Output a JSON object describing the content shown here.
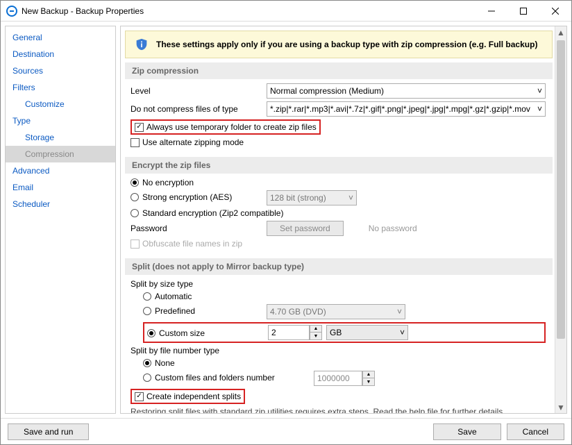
{
  "window": {
    "title": "New Backup - Backup Properties"
  },
  "sidebar": {
    "items": [
      {
        "label": "General"
      },
      {
        "label": "Destination"
      },
      {
        "label": "Sources"
      },
      {
        "label": "Filters"
      },
      {
        "label": "Customize"
      },
      {
        "label": "Type"
      },
      {
        "label": "Storage"
      },
      {
        "label": "Compression"
      },
      {
        "label": "Advanced"
      },
      {
        "label": "Email"
      },
      {
        "label": "Scheduler"
      }
    ]
  },
  "banner": {
    "text": "These settings apply only if you are using a backup type with zip compression (e.g. Full backup)"
  },
  "zip": {
    "header": "Zip compression",
    "level_label": "Level",
    "level_value": "Normal compression (Medium)",
    "nocompress_label": "Do not compress files of type",
    "nocompress_value": "*.zip|*.rar|*.mp3|*.avi|*.7z|*.gif|*.png|*.jpeg|*.jpg|*.mpg|*.gz|*.gzip|*.mov",
    "temp_label": "Always use temporary folder to create zip files",
    "altmode_label": "Use alternate zipping mode"
  },
  "enc": {
    "header": "Encrypt the zip files",
    "none": "No encryption",
    "aes": "Strong encryption (AES)",
    "aes_bits": "128 bit (strong)",
    "zip2": "Standard encryption (Zip2 compatible)",
    "pw_label": "Password",
    "pw_button": "Set password",
    "pw_status": "No password",
    "obfuscate": "Obfuscate file names in zip"
  },
  "split": {
    "header": "Split (does not apply to Mirror backup type)",
    "size_label": "Split by size type",
    "auto": "Automatic",
    "predef": "Predefined",
    "predef_value": "4.70 GB (DVD)",
    "custom": "Custom size",
    "custom_value": "2",
    "custom_unit": "GB",
    "filenum_label": "Split by file number type",
    "none": "None",
    "customfiles": "Custom files and folders number",
    "customfiles_value": "1000000",
    "indep": "Create independent splits",
    "note": "Restoring split files with standard zip utilities requires extra steps. Read the help file for further details."
  },
  "footer": {
    "saverun": "Save and run",
    "save": "Save",
    "cancel": "Cancel"
  }
}
